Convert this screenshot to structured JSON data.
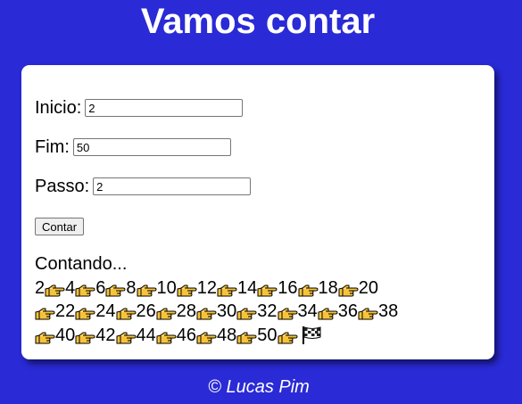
{
  "header": {
    "title": "Vamos contar"
  },
  "form": {
    "inicio_label": "Inicio:",
    "inicio_value": "2",
    "fim_label": "Fim:",
    "fim_value": "50",
    "passo_label": "Passo:",
    "passo_value": "2",
    "button_label": "Contar"
  },
  "result": {
    "status": "Contando...",
    "sequence": [
      2,
      4,
      6,
      8,
      10,
      12,
      14,
      16,
      18,
      20,
      22,
      24,
      26,
      28,
      30,
      32,
      34,
      36,
      38,
      40,
      42,
      44,
      46,
      48,
      50
    ],
    "separator_icon": "pointing-hand-icon",
    "end_icon": "checkered-flag-icon"
  },
  "footer": {
    "credit": "© Lucas Pim"
  },
  "colors": {
    "background": "#2a2ad6",
    "card": "#ffffff",
    "hand_fill": "#f7c33a"
  }
}
